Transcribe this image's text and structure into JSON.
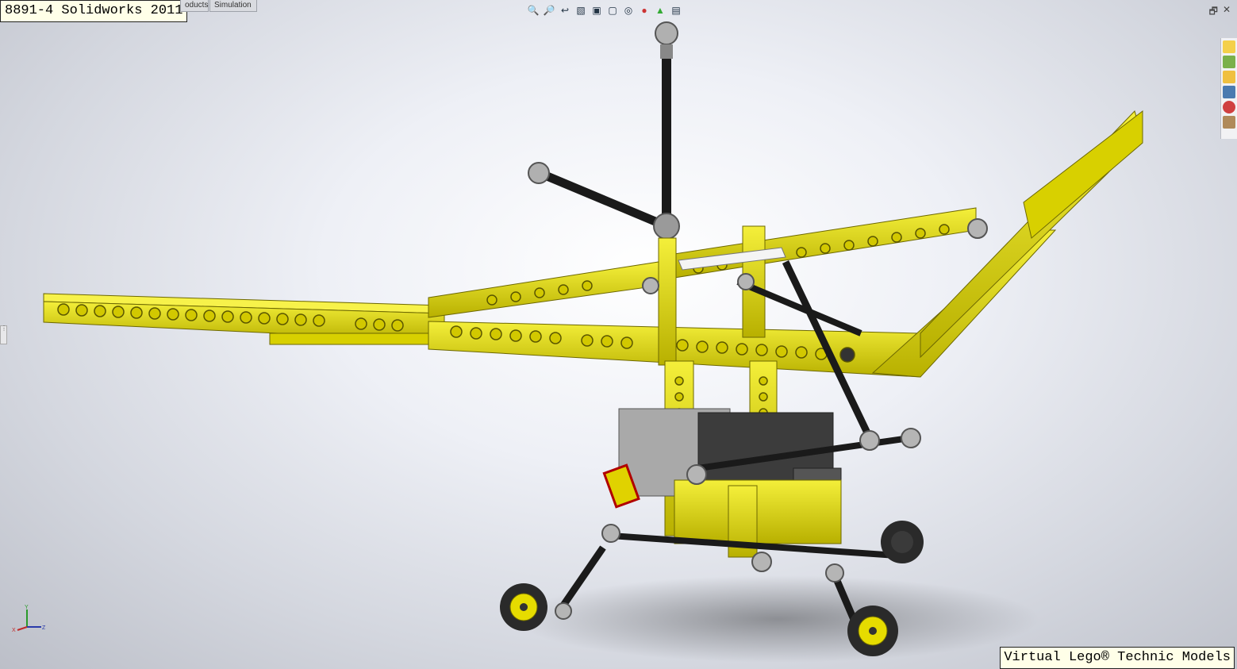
{
  "window": {
    "title_overlay": "8891-4 Solidworks 2011",
    "footer_overlay": "Virtual Lego® Technic Models"
  },
  "tabs": [
    {
      "label": "oducts"
    },
    {
      "label": "Simulation"
    }
  ],
  "heads_up_toolbar": {
    "icons": [
      "zoom-to-fit-icon",
      "zoom-area-icon",
      "previous-view-icon",
      "section-view-icon",
      "view-orientation-icon",
      "display-style-icon",
      "hide-show-items-icon",
      "edit-appearance-icon",
      "apply-scene-icon",
      "view-settings-icon"
    ]
  },
  "window_controls": {
    "restore": "🗗",
    "close": "✕"
  },
  "task_pane": {
    "icons": [
      "solidworks-resources-icon",
      "design-library-icon",
      "file-explorer-icon",
      "view-palette-icon",
      "appearances-scenes-icon",
      "custom-properties-icon"
    ]
  },
  "triad": {
    "x": "X",
    "y": "Y",
    "z": "Z"
  },
  "colors": {
    "technic_yellow": "#e8e00e",
    "technic_yellow_dark": "#8f8a00",
    "axle_black": "#1a1a1a",
    "connector_grey": "#a8a8a8",
    "tire_black": "#2a2a2a"
  }
}
